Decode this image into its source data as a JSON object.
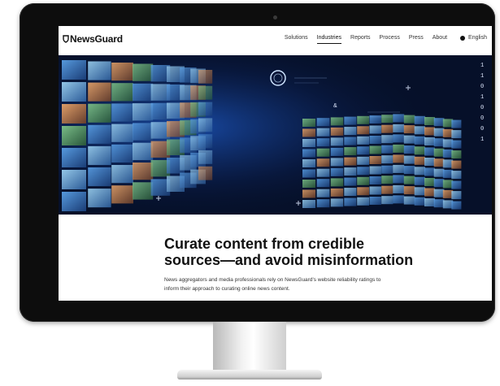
{
  "brand": {
    "name": "NewsGuard"
  },
  "nav": {
    "items": [
      {
        "label": "Solutions",
        "active": false
      },
      {
        "label": "Industries",
        "active": true
      },
      {
        "label": "Reports",
        "active": false
      },
      {
        "label": "Process",
        "active": false
      },
      {
        "label": "Press",
        "active": false
      },
      {
        "label": "About",
        "active": false
      }
    ],
    "language": "English"
  },
  "hero": {
    "symbol": "&",
    "binary": [
      "1",
      "1",
      "0",
      "1",
      "0",
      "0",
      "0",
      "1"
    ]
  },
  "content": {
    "headline_line1": "Curate content from credible",
    "headline_line2": "sources—and avoid misinformation",
    "subtext_line1": "News aggregators and media professionals rely on NewsGuard's website reliability ratings to",
    "subtext_line2": "inform their approach to curating online news content."
  },
  "colors": {
    "hero_bg": "#061029",
    "accent_blue": "#1f6fe0",
    "text": "#111111"
  }
}
